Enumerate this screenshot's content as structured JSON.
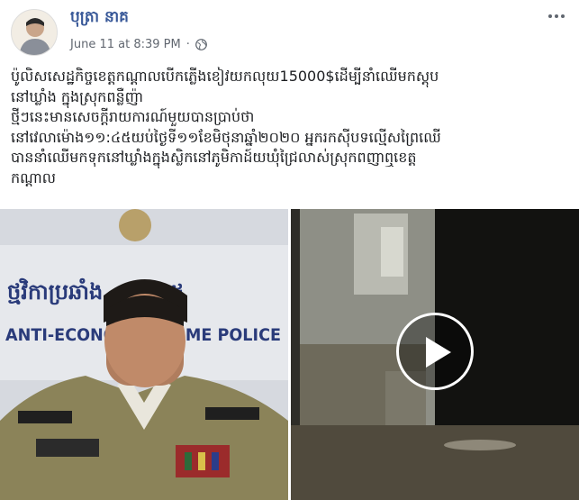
{
  "post": {
    "author": "បុត្រា នាគ",
    "timestamp": "June 11 at 8:39 PM",
    "separator": "·",
    "privacy_icon": "globe-icon",
    "more_icon": "more-options-icon",
    "text_lines": [
      "ប៉ូលិសសេដ្ឋកិច្ចខេត្តកណ្តាលបើកភ្លើងខៀវយកលុយ15000$ដើម្បីនាំឈើមកស្តុប",
      "នៅឃ្លាំង ក្នុងស្រុកពន្លឺញ៉ា",
      "ថ្មីៗនេះមានសេចក្តីរាយការណ៍មួយបានប្រាប់ថា",
      "នៅវេលាម៉ោង១១:៤៥យប់ថ្ងៃទី១១ខែមិថុនាឆ្នាំ២០២០ អ្នករកស៊ីបទល្មើសព្រៃឈើ",
      "បាននាំឈើមកទុកនៅឃ្លាំងក្នុងស្លិកនៅភូមិកាដ៍យឃុំជ្រៃលាស់ស្រុកពញាឮខេត្ត",
      "កណ្តាល"
    ]
  },
  "media": {
    "left_photo_banner": "ANTI-ECONOMIC CRIME POLICE",
    "play_icon": "play-icon"
  }
}
